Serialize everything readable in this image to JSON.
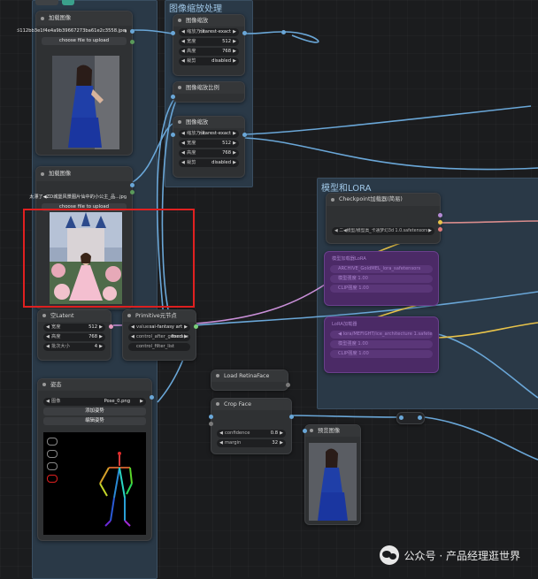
{
  "groups": {
    "image_scale": "图像缩放处理",
    "model_lora": "模型和LORA"
  },
  "load_image_1": {
    "title": "加载图像",
    "filename": "5112bb3e1f4e4a9b39667273ba61e2c3558.jpeg",
    "upload_btn": "choose file to upload"
  },
  "load_image_2": {
    "title": "加载图像",
    "filename": "太漂了◀ZD城堡风景图片仙中的小公主_品...jpg",
    "upload_btn": "choose file to upload"
  },
  "scale_node_1": {
    "title": "图像缩放",
    "rows": [
      {
        "label": "缩放方法",
        "value": "nearest-exact"
      },
      {
        "label": "宽度",
        "value": "512"
      },
      {
        "label": "高度",
        "value": "768"
      },
      {
        "label": "裁剪",
        "value": "disabled"
      }
    ]
  },
  "scale_ratio_node": {
    "title": "图像缩放比例"
  },
  "scale_node_2": {
    "title": "图像缩放",
    "rows": [
      {
        "label": "缩放方法",
        "value": "nearest-exact"
      },
      {
        "label": "宽度",
        "value": "512"
      },
      {
        "label": "高度",
        "value": "768"
      },
      {
        "label": "裁剪",
        "value": "disabled"
      }
    ]
  },
  "checkpoint": {
    "title": "Checkpoint加载器(简易)",
    "model": "◀ 二◀模型/模型类_卡通梦幻3d 1.0.safetensors"
  },
  "lora_rows_1": [
    "模型加载器LoRA",
    "ARCHIVE_GoldMEL_lora_safetensors",
    "模型强度 1.00",
    "CLIP强度 1.00"
  ],
  "lora_rows_2": [
    "LoRA加载器",
    "◀ lora/MEFIGHT/ice_architecture 1.safetensors",
    "模型强度 1.00",
    "CLIP强度 1.00"
  ],
  "empty_latent": {
    "title": "空Latent",
    "rows": [
      {
        "label": "宽度",
        "value": "512"
      },
      {
        "label": "高度",
        "value": "768"
      },
      {
        "label": "批次大小",
        "value": "4"
      }
    ]
  },
  "primitive": {
    "title": "Primitive元节点",
    "rows": [
      {
        "label": "value",
        "value": "sai-fantasy art"
      },
      {
        "label": "control_after_generate",
        "value": "fixed"
      },
      {
        "label": "control_filter_list",
        "value": ""
      }
    ]
  },
  "pose_node": {
    "title": "姿态",
    "image_label": "图像",
    "image_value": "Pose_0.png",
    "add_pose": "添加姿势",
    "edit_pose": "编辑姿势"
  },
  "retina": {
    "title": "Load RetinaFace"
  },
  "crop_face": {
    "title": "Crop Face",
    "rows": [
      {
        "label": "confidence",
        "value": "0.8"
      },
      {
        "label": "margin",
        "value": "32"
      }
    ]
  },
  "preview": {
    "title": "预览图像"
  },
  "watermark": "公众号 · 产品经理逛世界",
  "colors": {
    "wire_blue": "#6aa7d8",
    "wire_yellow": "#e8c34a",
    "wire_pink": "#c98fd8",
    "lora_purple": "#4b2a66",
    "group_blue": "#2b3a4a",
    "highlight_red": "#e02020"
  }
}
